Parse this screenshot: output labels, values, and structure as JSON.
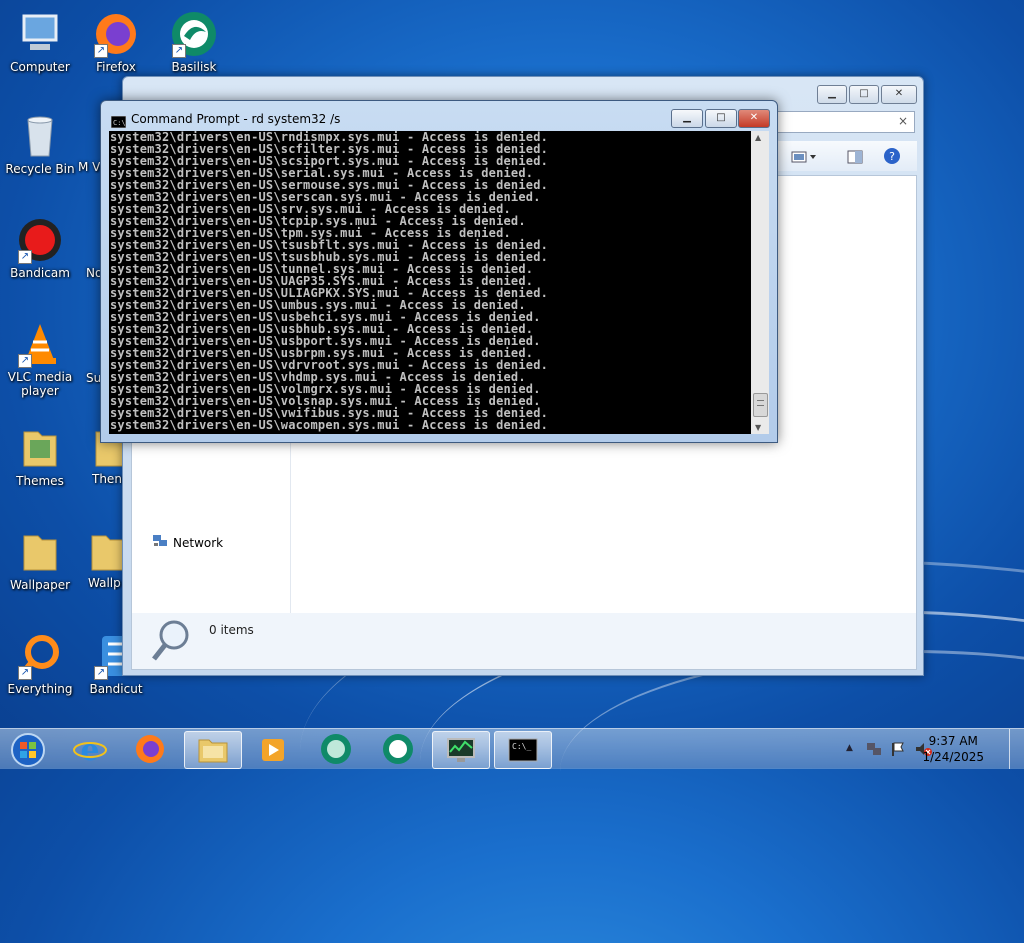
{
  "desktop": {
    "icons": [
      {
        "label": "Computer",
        "icon": "computer-icon"
      },
      {
        "label": "Firefox",
        "icon": "firefox-icon"
      },
      {
        "label": "Basilisk",
        "icon": "basilisk-icon"
      },
      {
        "label": "Recycle Bin",
        "icon": "recycle-bin-icon"
      },
      {
        "label": "Bandicam",
        "icon": "bandicam-icon"
      },
      {
        "label": "VLC media player",
        "icon": "vlc-icon"
      },
      {
        "label": "Themes",
        "icon": "folder-icon"
      },
      {
        "label": "Wallpaper",
        "icon": "folder-icon"
      },
      {
        "label": "Everything",
        "icon": "everything-icon"
      },
      {
        "label": "Bandicut",
        "icon": "bandicut-icon"
      },
      {
        "label": "M Visu",
        "icon": "partial-icon"
      },
      {
        "label": "No",
        "icon": "partial-icon"
      },
      {
        "label": "Su",
        "icon": "partial-icon"
      },
      {
        "label": "Then",
        "icon": "folder-icon"
      },
      {
        "label": "Wallp",
        "icon": "folder-icon"
      }
    ]
  },
  "explorer": {
    "nav_network": "Network",
    "status_items": "0 items"
  },
  "cmd": {
    "title": "Command Prompt - rd  system32 /s",
    "lines": [
      "system32\\drivers\\en-US\\rndismpx.sys.mui - Access is denied.",
      "system32\\drivers\\en-US\\scfilter.sys.mui - Access is denied.",
      "system32\\drivers\\en-US\\scsiport.sys.mui - Access is denied.",
      "system32\\drivers\\en-US\\serial.sys.mui - Access is denied.",
      "system32\\drivers\\en-US\\sermouse.sys.mui - Access is denied.",
      "system32\\drivers\\en-US\\serscan.sys.mui - Access is denied.",
      "system32\\drivers\\en-US\\srv.sys.mui - Access is denied.",
      "system32\\drivers\\en-US\\tcpip.sys.mui - Access is denied.",
      "system32\\drivers\\en-US\\tpm.sys.mui - Access is denied.",
      "system32\\drivers\\en-US\\tsusbflt.sys.mui - Access is denied.",
      "system32\\drivers\\en-US\\tsusbhub.sys.mui - Access is denied.",
      "system32\\drivers\\en-US\\tunnel.sys.mui - Access is denied.",
      "system32\\drivers\\en-US\\UAGP35.SYS.mui - Access is denied.",
      "system32\\drivers\\en-US\\ULIAGPKX.SYS.mui - Access is denied.",
      "system32\\drivers\\en-US\\umbus.sys.mui - Access is denied.",
      "system32\\drivers\\en-US\\usbehci.sys.mui - Access is denied.",
      "system32\\drivers\\en-US\\usbhub.sys.mui - Access is denied.",
      "system32\\drivers\\en-US\\usbport.sys.mui - Access is denied.",
      "system32\\drivers\\en-US\\usbrpm.sys.mui - Access is denied.",
      "system32\\drivers\\en-US\\vdrvroot.sys.mui - Access is denied.",
      "system32\\drivers\\en-US\\vhdmp.sys.mui - Access is denied.",
      "system32\\drivers\\en-US\\volmgrx.sys.mui - Access is denied.",
      "system32\\drivers\\en-US\\volsnap.sys.mui - Access is denied.",
      "system32\\drivers\\en-US\\vwifibus.sys.mui - Access is denied.",
      "system32\\drivers\\en-US\\wacompen.sys.mui - Access is denied."
    ]
  },
  "taskbar": {
    "items": [
      {
        "name": "start-button",
        "icon": "windows-orb-icon"
      },
      {
        "name": "internet-explorer",
        "icon": "ie-icon"
      },
      {
        "name": "firefox",
        "icon": "firefox-icon"
      },
      {
        "name": "windows-explorer",
        "icon": "folder-icon"
      },
      {
        "name": "media-player",
        "icon": "media-icon"
      },
      {
        "name": "basilisk-1",
        "icon": "basilisk-icon"
      },
      {
        "name": "basilisk-2",
        "icon": "basilisk-icon"
      },
      {
        "name": "task-manager",
        "icon": "monitor-icon"
      },
      {
        "name": "command-prompt",
        "icon": "cmd-icon"
      }
    ],
    "clock_time": "9:37 AM",
    "clock_date": "1/24/2025"
  },
  "colors": {
    "desktop_blue": "#1a6fcd",
    "cmd_text": "#c0c0c0",
    "close_red": "#c9483a"
  }
}
